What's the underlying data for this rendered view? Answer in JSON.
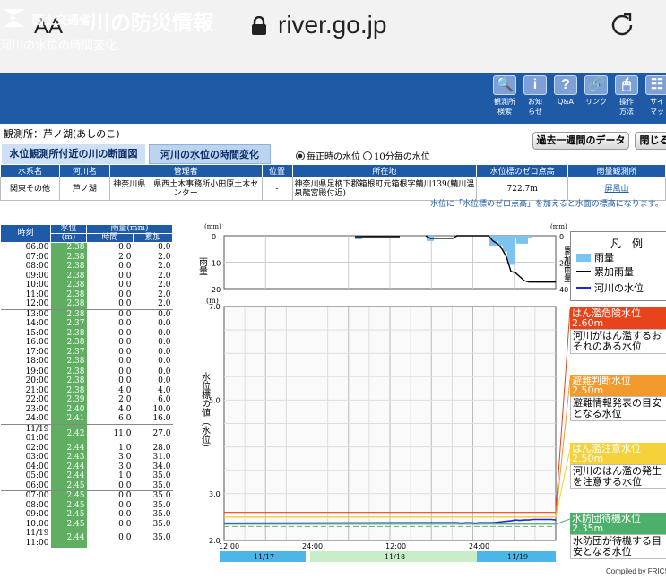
{
  "browser": {
    "aa": "AA",
    "url": "river.go.jp"
  },
  "header": {
    "ministry": "国土交通省",
    "title": "川の防災情報",
    "subtitle": "河川の水位の時間変化"
  },
  "nav": [
    {
      "icon": "search-icon",
      "glyph": "🔍",
      "label": "観測所\n検索"
    },
    {
      "icon": "info-icon",
      "glyph": "i",
      "label": "お知\nらせ"
    },
    {
      "icon": "help-icon",
      "glyph": "?",
      "label": "Q&A"
    },
    {
      "icon": "link-icon",
      "glyph": "🔗",
      "label": "リンク"
    },
    {
      "icon": "mouse-icon",
      "glyph": "🖱",
      "label": "操作\n方法"
    },
    {
      "icon": "sitemap-icon",
      "glyph": "☷",
      "label": "サイ\nマッ"
    }
  ],
  "station": "観測所：芦ノ湖(あしのこ)",
  "buttons": {
    "past_week": "過去一週間のデータ",
    "close": "閉じる"
  },
  "tabs": {
    "cross_section": "水位観測所付近の川の断面図",
    "time_change": "河川の水位の時間変化"
  },
  "radio": {
    "hourly": "毎正時の水位",
    "ten_min": "10分毎の水位"
  },
  "info_table": {
    "headers": [
      "水系名",
      "河川名",
      "管理者",
      "位置",
      "所在地",
      "水位標のゼロ点高",
      "雨量観測所"
    ],
    "row": [
      "関東その他",
      "芦ノ湖",
      "神奈川県　県西土木事務所小田原土木センター",
      "-",
      "神奈川県足柄下郡箱根町元箱根字鯖川139(鯖川温泉龍宮殿付近)",
      "722.7m",
      "屏風山"
    ]
  },
  "note": "水位に「水位標のゼロ点高」を加えると水面の標高になります。",
  "data_table": {
    "headers": {
      "time": "時刻",
      "level": "水位",
      "level_unit": "(m)",
      "rain": "雨量(mm)",
      "rain_hourly": "時間",
      "rain_cum": "累加"
    },
    "rows": [
      [
        "06:00",
        "2.38",
        "0.0",
        "0.0"
      ],
      [
        "07:00",
        "2.38",
        "2.0",
        "2.0"
      ],
      [
        "08:00",
        "2.38",
        "0.0",
        "2.0"
      ],
      [
        "09:00",
        "2.38",
        "0.0",
        "2.0"
      ],
      [
        "10:00",
        "2.38",
        "0.0",
        "2.0"
      ],
      [
        "11:00",
        "2.38",
        "0.0",
        "2.0"
      ],
      [
        "12:00",
        "2.38",
        "0.0",
        "2.0"
      ],
      [
        "13:00",
        "2.38",
        "0.0",
        "0.0"
      ],
      [
        "14:00",
        "2.37",
        "0.0",
        "0.0"
      ],
      [
        "15:00",
        "2.38",
        "0.0",
        "0.0"
      ],
      [
        "16:00",
        "2.38",
        "0.0",
        "0.0"
      ],
      [
        "17:00",
        "2.37",
        "0.0",
        "0.0"
      ],
      [
        "18:00",
        "2.38",
        "0.0",
        "0.0"
      ],
      [
        "19:00",
        "2.38",
        "0.0",
        "0.0"
      ],
      [
        "20:00",
        "2.38",
        "0.0",
        "0.0"
      ],
      [
        "21:00",
        "2.38",
        "4.0",
        "4.0"
      ],
      [
        "22:00",
        "2.39",
        "2.0",
        "6.0"
      ],
      [
        "23:00",
        "2.40",
        "4.0",
        "10.0"
      ],
      [
        "24:00",
        "2.41",
        "6.0",
        "16.0"
      ],
      [
        "11/19 01:00",
        "2.42",
        "11.0",
        "27.0"
      ],
      [
        "02:00",
        "2.44",
        "1.0",
        "28.0"
      ],
      [
        "03:00",
        "2.43",
        "3.0",
        "31.0"
      ],
      [
        "04:00",
        "2.44",
        "3.0",
        "34.0"
      ],
      [
        "05:00",
        "2.44",
        "1.0",
        "35.0"
      ],
      [
        "06:00",
        "2.45",
        "0.0",
        "35.0"
      ],
      [
        "07:00",
        "2.45",
        "0.0",
        "35.0"
      ],
      [
        "08:00",
        "2.45",
        "0.0",
        "35.0"
      ],
      [
        "09:00",
        "2.45",
        "0.0",
        "35.0"
      ],
      [
        "10:00",
        "2.45",
        "0.0",
        "35.0"
      ],
      [
        "11/19 11:00",
        "2.44",
        "0.0",
        "35.0"
      ]
    ]
  },
  "chart_data": {
    "type": "line",
    "rain_chart": {
      "ylabel": "雨量",
      "ylabel_right": "累加雨量",
      "left_unit": "(mm)",
      "right_unit": "(mm)",
      "left_ticks": [
        "0",
        "10",
        "20"
      ],
      "right_ticks": [
        "0",
        "20",
        "40"
      ],
      "ylim_left": [
        0,
        20
      ],
      "ylim_right": [
        0,
        40
      ]
    },
    "level_chart": {
      "ylabel": "水位標の値（水位）",
      "unit": "(m)",
      "ylim": [
        2.0,
        7.0
      ],
      "y_ticks": [
        "2.0",
        "3.0",
        "5.0",
        "7.0"
      ],
      "x_ticks": [
        "12:00",
        "24:00",
        "12:00",
        "24:00"
      ],
      "dates": [
        "11/17",
        "11/18",
        "11/19"
      ]
    },
    "thresholds": [
      {
        "name": "はん濫危険水位",
        "value": 2.6,
        "color": "#e8441c"
      },
      {
        "name": "避難判断水位",
        "value": 2.5,
        "color": "#f29a2e"
      },
      {
        "name": "はん濫注意水位",
        "value": 2.5,
        "color": "#f5d23c"
      },
      {
        "name": "水防団待機水位",
        "value": 2.35,
        "color": "#4caf6a"
      }
    ],
    "level_series": [
      2.38,
      2.38,
      2.38,
      2.38,
      2.38,
      2.38,
      2.38,
      2.38,
      2.37,
      2.38,
      2.38,
      2.37,
      2.38,
      2.38,
      2.38,
      2.38,
      2.39,
      2.4,
      2.41,
      2.42,
      2.44,
      2.43,
      2.44,
      2.44,
      2.45,
      2.45,
      2.45,
      2.45,
      2.45,
      2.44
    ],
    "hourly_rain": [
      0,
      2,
      0,
      0,
      0,
      0,
      0,
      0,
      0,
      0,
      0,
      0,
      0,
      0,
      0,
      4,
      2,
      4,
      6,
      11,
      1,
      3,
      3,
      1,
      0,
      0,
      0,
      0,
      0,
      0
    ],
    "cum_rain": [
      0,
      2,
      2,
      2,
      2,
      2,
      2,
      0,
      0,
      0,
      0,
      0,
      0,
      0,
      0,
      4,
      6,
      10,
      16,
      27,
      28,
      31,
      34,
      35,
      35,
      35,
      35,
      35,
      35,
      35
    ]
  },
  "legend": {
    "title": "凡　例",
    "rain": "雨量",
    "cum_rain": "累加雨量",
    "level": "河川の水位",
    "items": [
      {
        "label": "はん濫危険水位",
        "value": "2.60m",
        "desc": "河川がはん濫するおそれのある水位"
      },
      {
        "label": "避難判断水位",
        "value": "2.50m",
        "desc": "避難情報発表の目安となる水位"
      },
      {
        "label": "はん濫注意水位",
        "value": "2.50m",
        "desc": "河川のはん濫の発生を注意する水位"
      },
      {
        "label": "水防団待機水位",
        "value": "2.35m",
        "desc": "水防団が待機する目安となる水位"
      }
    ]
  },
  "copyright": "Compiled by FRICS"
}
